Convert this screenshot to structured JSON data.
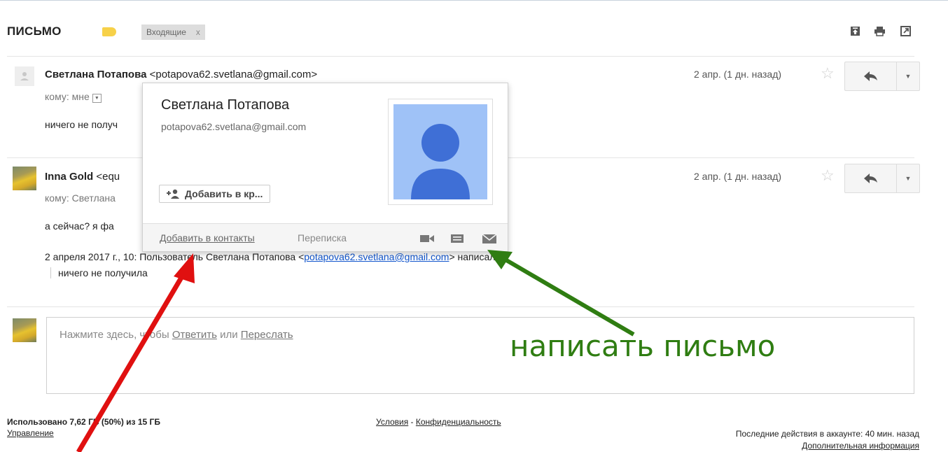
{
  "header": {
    "subject": "ПИСЬМО",
    "label_chip": "Входящие",
    "label_chip_close": "x",
    "icons": [
      "archive-icon",
      "print-icon",
      "new-window-icon"
    ]
  },
  "message1": {
    "sender_name": "Светлана Потапова",
    "sender_email": "<potapova62.svetlana@gmail.com>",
    "to": "кому: мне",
    "snippet": "ничего не получ",
    "date": "2 апр. (1 дн. назад)"
  },
  "message2": {
    "sender_name": "Inna Gold",
    "sender_email": "<equ",
    "to": "кому: Светлана",
    "body_line": "а сейчас? я фа",
    "quote_header_pre": "2 апреля 2017 г., 10: Пользователь Светлана Потапова <",
    "quote_header_link": "potapova62.svetlana@gmail.com",
    "quote_header_post": "> написал:",
    "quote_text": "ничего не получила",
    "date": "2 апр. (1 дн. назад)"
  },
  "reply_box": {
    "prefix": "Нажмите здесь, чтобы ",
    "reply_link": "Ответить",
    "or": " или ",
    "forward_link": "Переслать"
  },
  "contact_card": {
    "name": "Светлана Потапова",
    "email": "potapova62.svetlana@gmail.com",
    "add_button": "Добавить в кр...",
    "footer_add_contacts": "Добавить в контакты",
    "footer_conversation": "Переписка",
    "footer_icons": [
      "video-call-icon",
      "chat-icon",
      "email-icon"
    ]
  },
  "footer": {
    "storage": "Использовано 7,62 ГБ (50%) из 15 ГБ",
    "manage": "Управление",
    "terms": "Условия",
    "dash": " - ",
    "privacy": "Конфиденциальность",
    "last_activity": "Последние действия в аккаунте: 40 мин. назад",
    "details": "Дополнительная информация"
  },
  "annotation": {
    "text": "написать письмо",
    "color": "#2f7d12",
    "arrow_colors": [
      "#e01010",
      "#2f7d12"
    ]
  }
}
